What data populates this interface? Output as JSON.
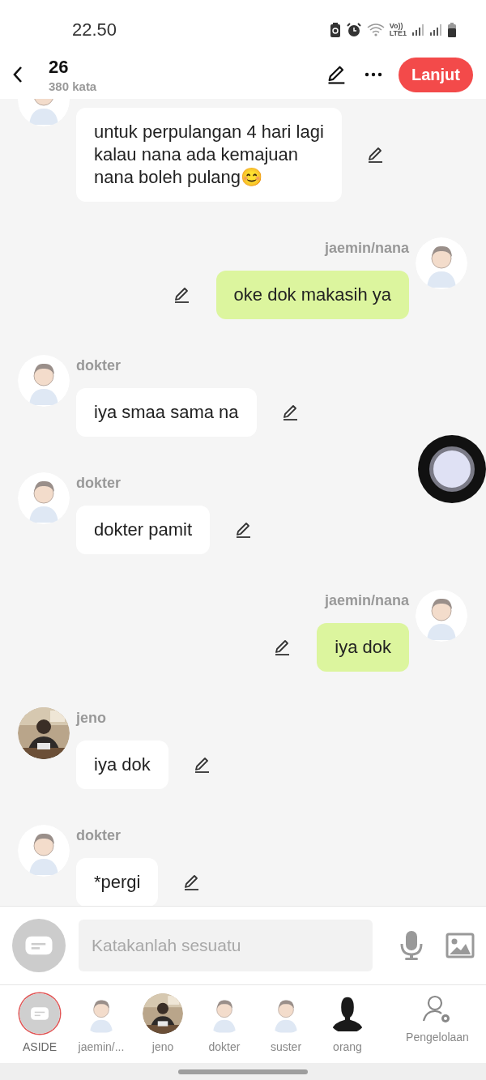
{
  "status_bar": {
    "time": "22.50",
    "network_label": [
      "Vo))",
      "LTE1"
    ]
  },
  "header": {
    "title": "26",
    "subtitle": "380 kata",
    "next_button": "Lanjut"
  },
  "messages": [
    {
      "kind": "incoming",
      "avatar": {
        "kind": "illustration"
      },
      "text": "untuk perpulangan 4 hari lagi\nkalau nana ada kemajuan\nnana boleh pulang😊"
    },
    {
      "kind": "outgoing",
      "name": "jaemin/nana",
      "avatar": {
        "kind": "illustration"
      },
      "text": "oke dok makasih ya"
    },
    {
      "kind": "incoming",
      "name": "dokter",
      "avatar": {
        "kind": "illustration"
      },
      "text": "iya smaa sama na"
    },
    {
      "kind": "incoming",
      "name": "dokter",
      "avatar": {
        "kind": "illustration"
      },
      "text": "dokter pamit"
    },
    {
      "kind": "outgoing",
      "name": "jaemin/nana",
      "avatar": {
        "kind": "illustration"
      },
      "text": "iya dok"
    },
    {
      "kind": "incoming",
      "name": "jeno",
      "text": "iya dok"
    },
    {
      "kind": "incoming",
      "name": "dokter",
      "avatar": {
        "kind": "illustration"
      },
      "text": "*pergi"
    }
  ],
  "composer": {
    "placeholder": "Katakanlah sesuatu"
  },
  "characters": [
    {
      "label": "ASIDE",
      "avatar": {
        "kind": "narration"
      },
      "selected": true
    },
    {
      "label": "jaemin/...",
      "avatar": {
        "kind": "illustration"
      },
      "selected": false
    },
    {
      "label": "jeno",
      "selected": false
    },
    {
      "label": "dokter",
      "avatar": {
        "kind": "illustration"
      },
      "selected": false
    },
    {
      "label": "suster",
      "avatar": {
        "kind": "illustration"
      },
      "selected": false
    },
    {
      "label": "orang",
      "avatar": {
        "kind": "silhouette"
      },
      "selected": false
    }
  ],
  "manage_label": "Pengelolaan"
}
